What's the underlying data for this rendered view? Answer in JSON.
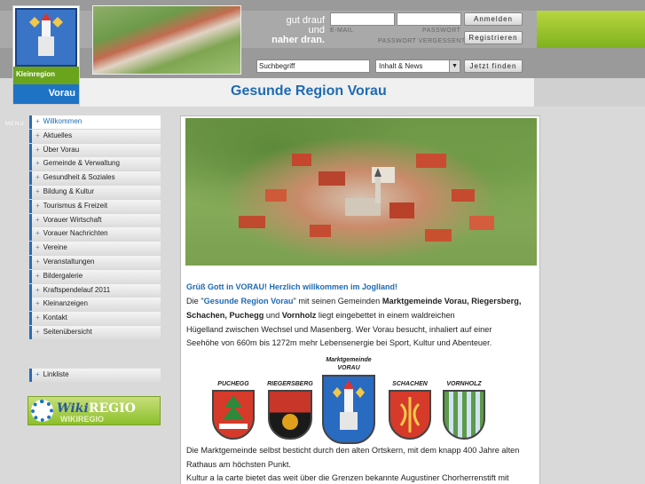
{
  "header": {
    "logo_top": "Kleinregion",
    "logo_bottom": "Vorau",
    "slogan_line1": "gut drauf",
    "slogan_line2": "und",
    "slogan_line3": "naher dran."
  },
  "login": {
    "email_label": "E-MAIL",
    "password_label": "PASSWORT",
    "forgot_label": "PASSWORT VERGESSEN?",
    "login_button": "Anmelden",
    "register_button": "Registrieren"
  },
  "search": {
    "placeholder": "Suchbegriff",
    "value": "Suchbegriff",
    "select_value": "Inhalt & News",
    "find_button": "Jetzt finden"
  },
  "page_title": "Gesunde Region Vorau",
  "menu_label": "MENU",
  "nav": {
    "items": [
      {
        "label": "Willkommen"
      },
      {
        "label": "Aktuelles"
      },
      {
        "label": "Über Vorau"
      },
      {
        "label": "Gemeinde & Verwaltung"
      },
      {
        "label": "Gesundheit & Soziales"
      },
      {
        "label": "Bildung & Kultur"
      },
      {
        "label": "Tourismus & Freizeit"
      },
      {
        "label": "Vorauer Wirtschaft"
      },
      {
        "label": "Vorauer Nachrichten"
      },
      {
        "label": "Vereine"
      },
      {
        "label": "Veranstaltungen"
      },
      {
        "label": "Bildergalerie"
      },
      {
        "label": "Kraftspendelauf 2011"
      },
      {
        "label": "Kleinanzeigen"
      },
      {
        "label": "Kontakt"
      },
      {
        "label": "Seitenübersicht"
      }
    ],
    "extra": "Linkliste"
  },
  "wiki": {
    "brand_a": "Wiki",
    "brand_b": "REGIO",
    "brand_shadow": "WIKIREGIO"
  },
  "content": {
    "welcome": "Grüß Gott in VORAU! Herzlich willkommen im Joglland!",
    "p1_a": "Die \"",
    "p1_b": "Gesunde Region Vorau",
    "p1_c": "\" mit seinen Gemeinden ",
    "p1_d": "Marktgemeinde Vorau, Riegersberg,",
    "p1_e": "Schachen, Puchegg",
    "p1_f": " und ",
    "p1_g": "Vornholz",
    "p1_h": " liegt eingebettet in einem waldreichen",
    "p1_line3": "Hügelland zwischen Wechsel und Masenberg. Wer Vorau besucht, inhaliert auf einer",
    "p1_line4": "Seehöhe von 660m bis 1272m mehr Lebensenergie bei Sport, Kultur und Abenteuer.",
    "crests": [
      {
        "name": "PUCHEGG",
        "color": "#d63a2a"
      },
      {
        "name": "RIEGERSBERG",
        "color": "#c8362a"
      },
      {
        "name": "Marktgemeinde VORAU",
        "color": "#2a6bc2"
      },
      {
        "name": "SCHACHEN",
        "color": "#d63a2a"
      },
      {
        "name": "VORNHOLZ",
        "color": "#5e9a4a"
      }
    ],
    "p2_line1": "Die Marktgemeinde selbst besticht durch den alten Ortskern, mit dem knapp 400 Jahre alten",
    "p2_line2": "Rathaus am höchsten Punkt.",
    "p3_line1": "Kultur a la carte bietet das weit über die Grenzen bekannte Augustiner Chorherrenstift mit"
  }
}
